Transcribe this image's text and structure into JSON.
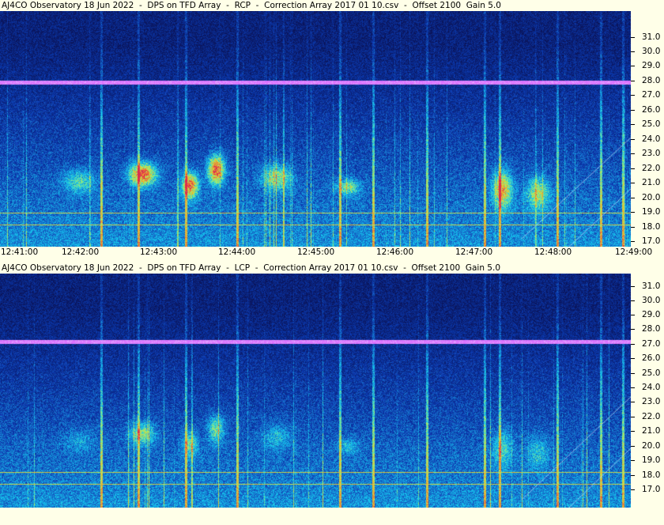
{
  "panels": [
    {
      "title": "AJ4CO Observatory 18 Jun 2022  -  DPS on TFD Array  -  RCP  -  Correction Array 2017 01 10.csv  -  Offset 2100  Gain 5.0",
      "polarization": "RCP",
      "y_labels": [
        "31.0",
        "30.0",
        "29.0",
        "28.0",
        "27.0",
        "26.0",
        "25.0",
        "24.0",
        "23.0",
        "22.0",
        "21.0",
        "20.0",
        "19.0",
        "18.0",
        "17.0"
      ],
      "x_labels": [
        "12:41:00",
        "12:42:00",
        "12:43:00",
        "12:44:00",
        "12:45:00",
        "12:46:00",
        "12:47:00",
        "12:48:00",
        "12:49:00"
      ]
    },
    {
      "title": "AJ4CO Observatory 18 Jun 2022  -  DPS on TFD Array  -  LCP  -  Correction Array 2017 01 10.csv  -  Offset 2100  Gain 5.0",
      "polarization": "LCP",
      "y_labels": [
        "31.0",
        "30.0",
        "29.0",
        "28.0",
        "27.0",
        "26.0",
        "25.0",
        "24.0",
        "23.0",
        "22.0",
        "21.0",
        "20.0",
        "19.0",
        "18.0",
        "17.0"
      ],
      "x_labels": []
    }
  ],
  "colors": {
    "background": "#ffffe8",
    "spectrogram_low": "#0a1a66",
    "spectrogram_mid": "#1e6fd0",
    "spectrogram_high": "#7fe0ff",
    "burst": "#d0303a"
  }
}
